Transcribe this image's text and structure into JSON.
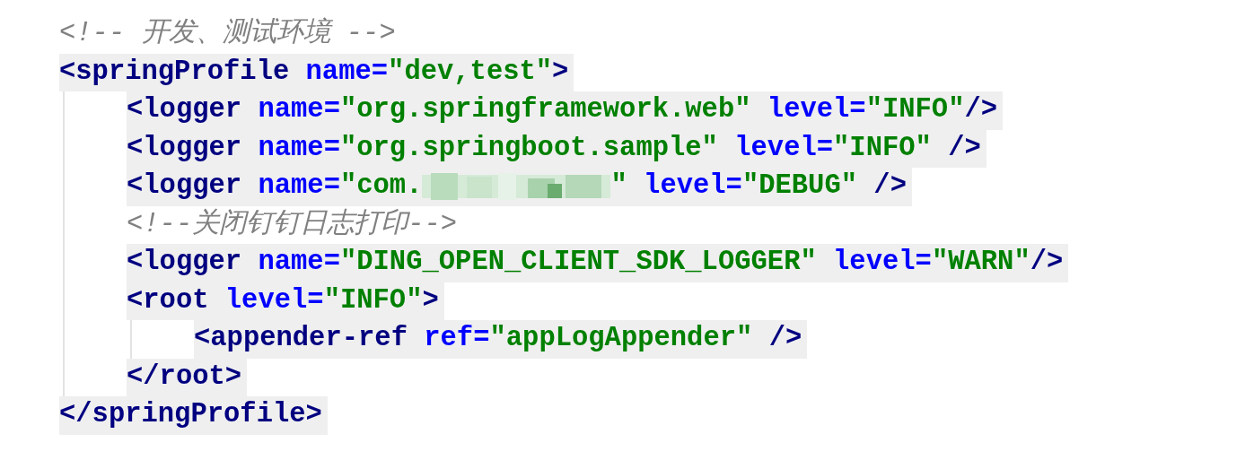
{
  "code": [
    {
      "kind": "comment",
      "text": "<!-- 开发、测试环境 -->"
    },
    {
      "kind": "element",
      "tokens": [
        {
          "kind": "tag",
          "text": "<springProfile"
        },
        {
          "kind": "attr",
          "text": " name="
        },
        {
          "kind": "value",
          "text": "\"dev,test\""
        },
        {
          "kind": "tag",
          "text": ">"
        }
      ],
      "children": [
        {
          "kind": "element",
          "tokens": [
            {
              "kind": "tag",
              "text": "<logger"
            },
            {
              "kind": "attr",
              "text": " name="
            },
            {
              "kind": "value",
              "text": "\"org.springframework.web\""
            },
            {
              "kind": "attr",
              "text": " level="
            },
            {
              "kind": "value",
              "text": "\"INFO\""
            },
            {
              "kind": "tag",
              "text": "/>"
            }
          ]
        },
        {
          "kind": "element",
          "tokens": [
            {
              "kind": "tag",
              "text": "<logger"
            },
            {
              "kind": "attr",
              "text": " name="
            },
            {
              "kind": "value",
              "text": "\"org.springboot.sample\""
            },
            {
              "kind": "attr",
              "text": " level="
            },
            {
              "kind": "value",
              "text": "\"INFO\""
            },
            {
              "kind": "tag",
              "text": " />"
            }
          ]
        },
        {
          "kind": "element",
          "tokens": [
            {
              "kind": "tag",
              "text": "<logger"
            },
            {
              "kind": "attr",
              "text": " name="
            },
            {
              "kind": "value",
              "text": "\"com."
            },
            {
              "kind": "redacted"
            },
            {
              "kind": "value",
              "text": "\""
            },
            {
              "kind": "attr",
              "text": " level="
            },
            {
              "kind": "value",
              "text": "\"DEBUG\""
            },
            {
              "kind": "tag",
              "text": " />"
            }
          ]
        },
        {
          "kind": "comment",
          "text": "<!--关闭钉钉日志打印-->"
        },
        {
          "kind": "element",
          "tokens": [
            {
              "kind": "tag",
              "text": "<logger"
            },
            {
              "kind": "attr",
              "text": " name="
            },
            {
              "kind": "value",
              "text": "\"DING_OPEN_CLIENT_SDK_LOGGER\""
            },
            {
              "kind": "attr",
              "text": " level="
            },
            {
              "kind": "value",
              "text": "\"WARN\""
            },
            {
              "kind": "tag",
              "text": "/>"
            }
          ]
        },
        {
          "kind": "element",
          "tokens": [
            {
              "kind": "tag",
              "text": "<root"
            },
            {
              "kind": "attr",
              "text": " level="
            },
            {
              "kind": "value",
              "text": "\"INFO\""
            },
            {
              "kind": "tag",
              "text": ">"
            }
          ],
          "children": [
            {
              "kind": "element",
              "tokens": [
                {
                  "kind": "tag",
                  "text": "<appender-ref"
                },
                {
                  "kind": "attr",
                  "text": " ref="
                },
                {
                  "kind": "value",
                  "text": "\"appLogAppender\""
                },
                {
                  "kind": "tag",
                  "text": " />"
                }
              ]
            }
          ]
        },
        {
          "kind": "element",
          "tokens": [
            {
              "kind": "tag",
              "text": "</root>"
            }
          ]
        }
      ]
    },
    {
      "kind": "element",
      "tokens": [
        {
          "kind": "tag",
          "text": "</springProfile>"
        }
      ]
    }
  ]
}
